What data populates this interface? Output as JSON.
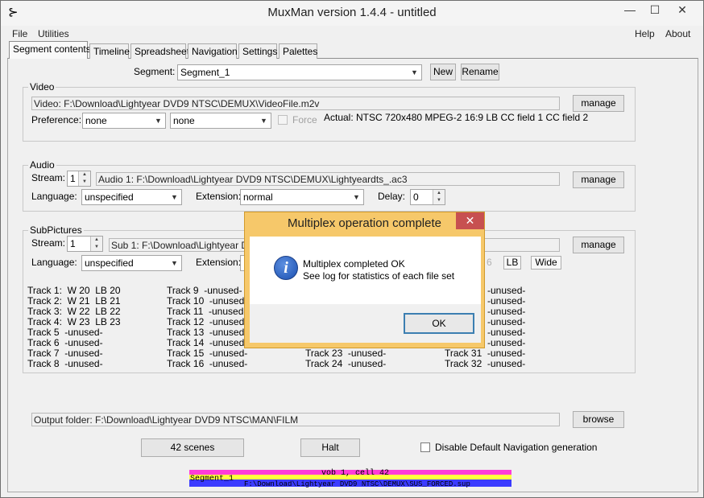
{
  "window": {
    "title": "MuxMan version 1.4.4 - untitled",
    "min_glyph": "—",
    "max_glyph": "☐",
    "close_glyph": "✕",
    "app_glyph": "⊱"
  },
  "menu": {
    "left": [
      "File",
      "Utilities"
    ],
    "right": [
      "Help",
      "About"
    ]
  },
  "tabs": [
    "Segment contents",
    "Timeline",
    "Spreadsheet",
    "Navigation",
    "Settings",
    "Palettes"
  ],
  "segment": {
    "label": "Segment:",
    "value": "Segment_1",
    "new_label": "New",
    "rename_label": "Rename"
  },
  "video": {
    "title": "Video",
    "file": "Video: F:\\Download\\Lightyear DVD9 NTSC\\DEMUX\\VideoFile.m2v",
    "manage_label": "manage",
    "preference_label": "Preference:",
    "pref1": "none",
    "pref2": "none",
    "force_label": "Force",
    "actual": "Actual: NTSC 720x480  MPEG-2  16:9 LB  CC field 1  CC field 2"
  },
  "audio": {
    "title": "Audio",
    "stream_label": "Stream:",
    "stream_value": "1",
    "file": "Audio 1: F:\\Download\\Lightyear DVD9 NTSC\\DEMUX\\Lightyeardts_.ac3",
    "manage_label": "manage",
    "language_label": "Language:",
    "language_value": "unspecified",
    "extension_label": "Extension:",
    "extension_value": "normal",
    "delay_label": "Delay:",
    "delay_value": "0"
  },
  "subpictures": {
    "title": "SubPictures",
    "stream_label": "Stream:",
    "stream_value": "1",
    "file": "Sub 1: F:\\Download\\Lightyear DVD9 NTSC\\DEMUX\\",
    "manage_label": "manage",
    "language_label": "Language:",
    "language_value": "unspecified",
    "extension_label": "Extension:",
    "hidden_six": "6",
    "lb_label": "LB",
    "wide_label": "Wide",
    "tracks_col1": [
      "Track 1:  W 20  LB 20",
      "Track 2:  W 21  LB 21",
      "Track 3:  W 22  LB 22",
      "Track 4:  W 23  LB 23",
      "Track 5  -unused-",
      "Track 6  -unused-",
      "Track 7  -unused-",
      "Track 8  -unused-"
    ],
    "tracks_col2": [
      "Track 9  -unused-",
      "Track 10  -unused-",
      "Track 11  -unused-",
      "Track 12  -unused-",
      "Track 13  -unused-",
      "Track 14  -unused-",
      "Track 15  -unused-",
      "Track 16  -unused-"
    ],
    "tracks_col3": [
      "Track 23  -unused-",
      "Track 24  -unused-"
    ],
    "tracks_col4_top": [
      "-unused-",
      "-unused-",
      "-unused-",
      "-unused-",
      "-unused-",
      "-unused-"
    ],
    "tracks_col4": [
      "Track 31  -unused-",
      "Track 32  -unused-"
    ]
  },
  "output": {
    "folder": "Output folder: F:\\Download\\Lightyear DVD9 NTSC\\MAN\\FILM",
    "browse_label": "browse"
  },
  "bottom": {
    "scenes_label": "42 scenes",
    "halt_label": "Halt",
    "disable_nav_label": "Disable Default Navigation generation"
  },
  "progress": {
    "vob_text": "vob 1, cell 42",
    "segment_text": "Segment_1",
    "file_text": "F:\\Download\\Lightyear DVD9 NTSC\\DEMUX\\SUS_FORCED.sup"
  },
  "dialog": {
    "title": "Multiplex operation complete",
    "close_glyph": "✕",
    "icon_glyph": "i",
    "line1": "Multiplex completed OK",
    "line2": "See log for statistics of each file set",
    "ok_label": "OK"
  },
  "colors": {
    "dialog_frame": "#f6c86a",
    "close_red": "#c75050",
    "progress_magenta": "#ff3bd8",
    "progress_yellow": "#ffff3f",
    "progress_blue": "#3b3bff"
  }
}
